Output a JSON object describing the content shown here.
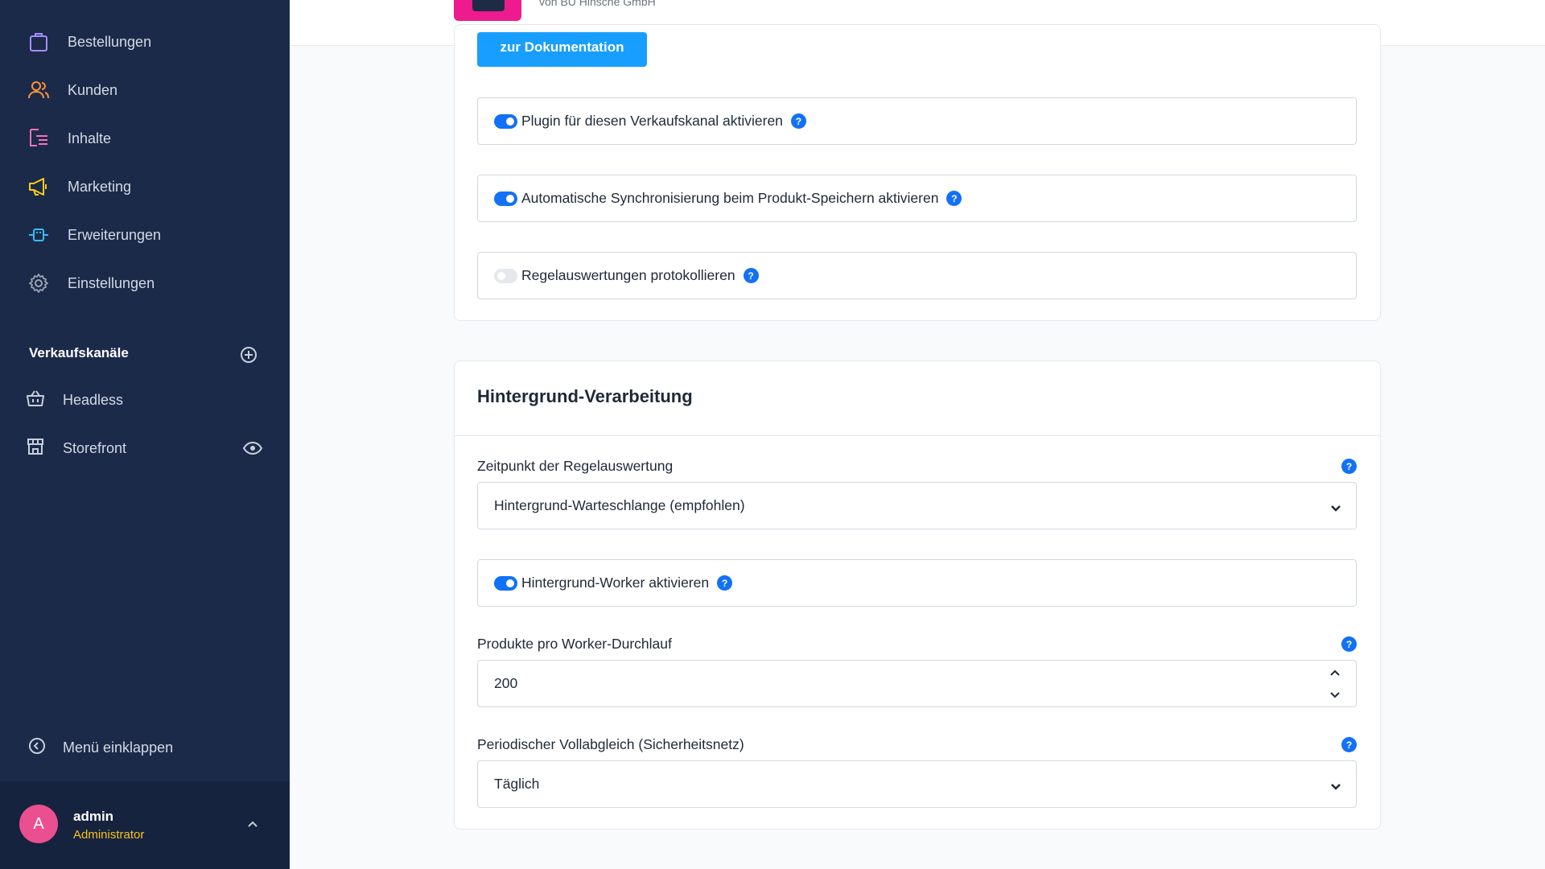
{
  "sidebar": {
    "items": [
      {
        "label": "Bestellungen",
        "icon": "shopping-bag-icon",
        "color": "#a78bfa"
      },
      {
        "label": "Kunden",
        "icon": "users-icon",
        "color": "#fb923c"
      },
      {
        "label": "Inhalte",
        "icon": "content-list-icon",
        "color": "#f472b6"
      },
      {
        "label": "Marketing",
        "icon": "megaphone-icon",
        "color": "#facc15"
      },
      {
        "label": "Erweiterungen",
        "icon": "plug-icon",
        "color": "#38bdf8"
      },
      {
        "label": "Einstellungen",
        "icon": "gear-icon",
        "color": "#9ca3af"
      }
    ],
    "sales_channels_title": "Verkaufskanäle",
    "channels": [
      {
        "label": "Headless",
        "icon": "basket-icon"
      },
      {
        "label": "Storefront",
        "icon": "storefront-icon"
      }
    ],
    "collapse_label": "Menü einklappen",
    "user": {
      "initial": "A",
      "name": "admin",
      "role": "Administrator"
    }
  },
  "header": {
    "vendor": "von BU Hinsche GmbH"
  },
  "settings": {
    "doc_button": "zur Dokumentation",
    "toggles": [
      {
        "label": "Plugin für diesen Verkaufskanal aktivieren",
        "enabled": true
      },
      {
        "label": "Automatische Synchronisierung beim Produkt-Speichern aktivieren",
        "enabled": true
      },
      {
        "label": "Regelauswertungen protokollieren",
        "enabled": false
      }
    ]
  },
  "background": {
    "title": "Hintergrund-Verarbeitung",
    "evaluation_time_label": "Zeitpunkt der Regelauswertung",
    "evaluation_time_value": "Hintergrund-Warteschlange (empfohlen)",
    "worker_toggle_label": "Hintergrund-Worker aktivieren",
    "worker_enabled": true,
    "products_per_run_label": "Produkte pro Worker-Durchlauf",
    "products_per_run_value": "200",
    "full_sync_label": "Periodischer Vollabgleich (Sicherheitsnetz)",
    "full_sync_value": "Täglich"
  },
  "help_glyph": "?",
  "colors": {
    "sidebar": "#1c2a4a",
    "accent": "#1271f5",
    "button": "#189eff",
    "avatar": "#ec4f90",
    "role": "#f8c21b"
  }
}
